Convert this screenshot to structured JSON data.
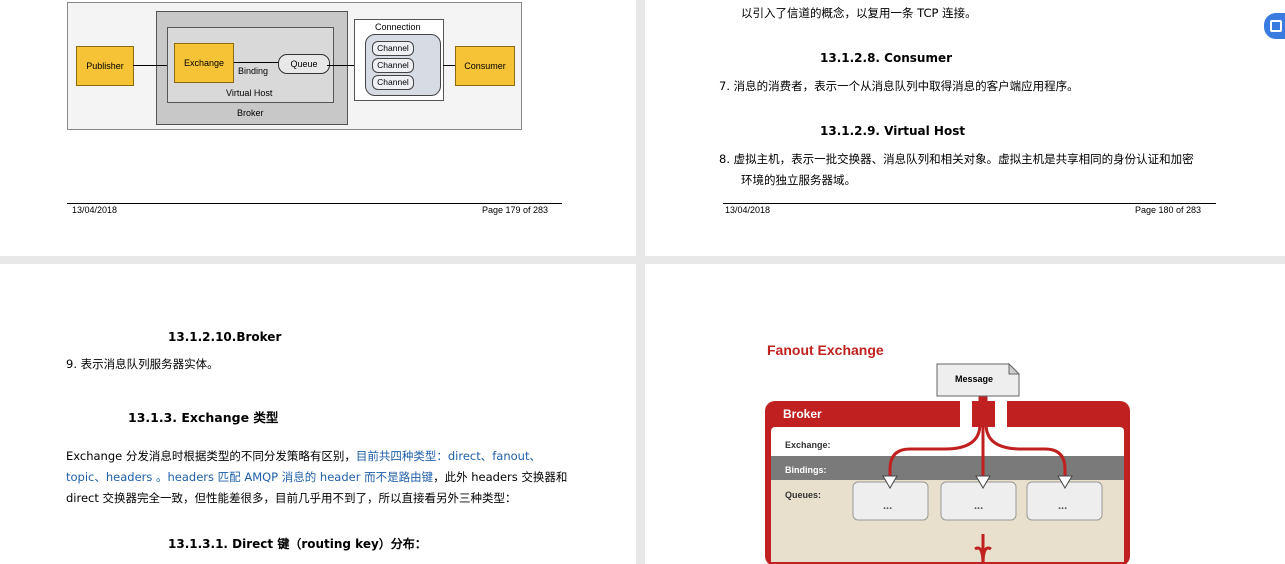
{
  "page179": {
    "diagram": {
      "publisher": "Publisher",
      "exchange": "Exchange",
      "binding": "Binding",
      "queue": "Queue",
      "virtual_host": "Virtual Host",
      "broker": "Broker",
      "connection": "Connection",
      "channels": [
        "Channel",
        "Channel",
        "Channel"
      ],
      "consumer": "Consumer"
    },
    "footer_date": "13/04/2018",
    "footer_page": "Page 179 of 283"
  },
  "page180": {
    "line_top": "以引入了信道的概念，以复用一条 TCP 连接。",
    "heading_consumer": "13.1.2.8.  Consumer",
    "item7": "7.   消息的消费者，表示一个从消息队列中取得消息的客户端应用程序。",
    "heading_vhost": "13.1.2.9.  Virtual Host",
    "item8_line1": "8.   虚拟主机，表示一批交换器、消息队列和相关对象。虚拟主机是共享相同的身份认证和加密",
    "item8_line2": "环境的独立服务器域。",
    "footer_date": "13/04/2018",
    "footer_page": "Page 180 of 283"
  },
  "page181": {
    "heading_broker": "13.1.2.10.Broker",
    "item9": "9.   表示消息队列服务器实体。",
    "heading_exchange_types": "13.1.3.      Exchange 类型",
    "para_part1": "Exchange 分发消息时根据类型的不同分发策略有区别，",
    "para_part2_blue": "目前共四种类型：direct、fanout、",
    "para_line2_blue": "topic、headers 。headers 匹配 AMQP 消息的 header 而不是路由键",
    "para_line2_rest": "，此外 headers 交换器和",
    "para_line3": "direct 交换器完全一致，但性能差很多，目前几乎用不到了，所以直接看另外三种类型：",
    "heading_direct": "13.1.3.1.  Direct 键（routing key）分布："
  },
  "page182": {
    "fanout_title": "Fanout Exchange",
    "message": "Message",
    "broker": "Broker",
    "exchange_label": "Exchange:",
    "bindings_label": "Bindings:",
    "queues_label": "Queues:",
    "queue_dots": [
      "...",
      "...",
      "..."
    ]
  },
  "colors": {
    "accent_red": "#c0201f",
    "yellow_box": "#f5c335",
    "link_blue": "#1f5fa8"
  }
}
